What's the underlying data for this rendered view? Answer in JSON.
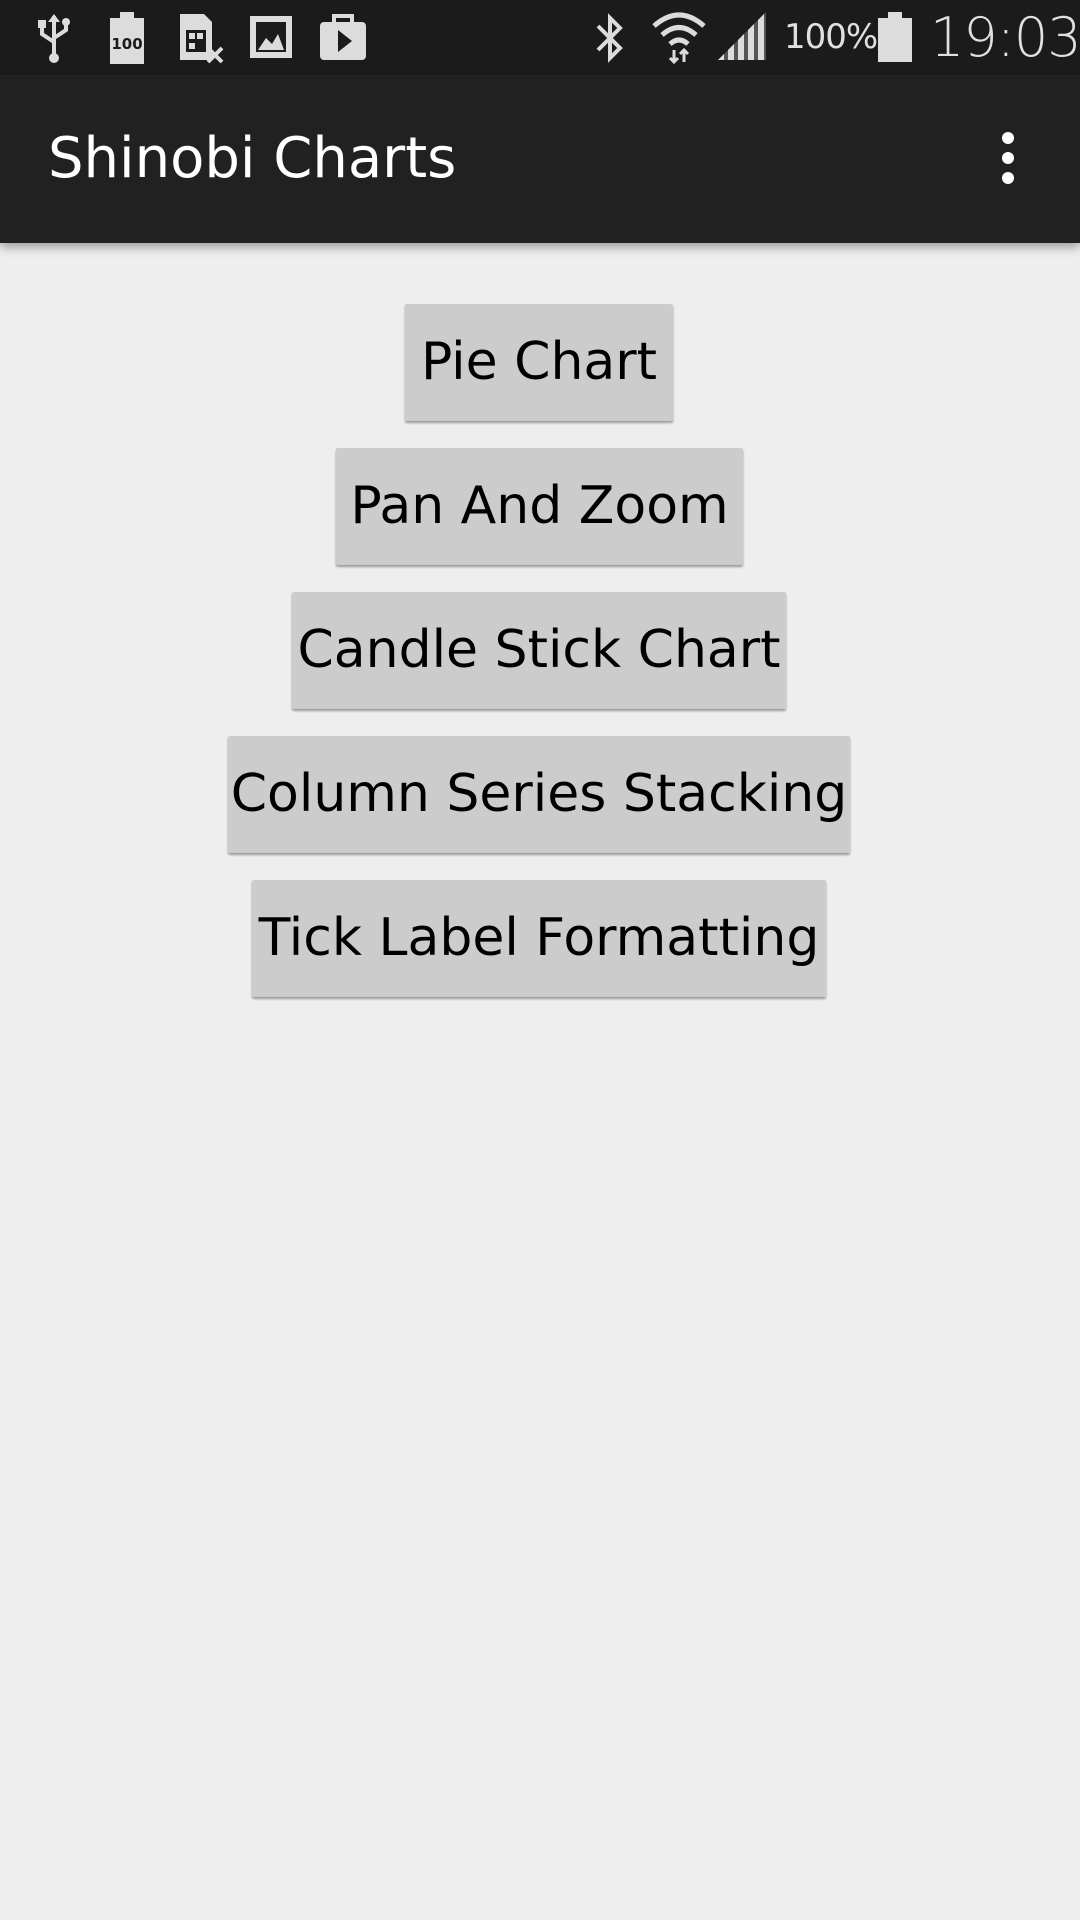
{
  "status_bar": {
    "left_icons": [
      "usb-icon",
      "battery-100-icon",
      "sim-card-icon",
      "image-icon",
      "play-store-icon"
    ],
    "right_icons": [
      "bluetooth-icon",
      "wifi-icon",
      "signal-icon",
      "battery-icon"
    ],
    "battery_percent": "100%",
    "time": "19:03"
  },
  "app_bar": {
    "title": "Shinobi Charts",
    "menu_icon": "overflow-menu-icon"
  },
  "buttons": [
    {
      "label": "Pie Chart"
    },
    {
      "label": "Pan And Zoom"
    },
    {
      "label": "Candle Stick Chart"
    },
    {
      "label": "Column Series Stacking"
    },
    {
      "label": "Tick Label Formatting"
    }
  ],
  "colors": {
    "status_bar_bg": "#1b1b1b",
    "app_bar_bg": "#212121",
    "page_bg": "#eeeeee",
    "button_bg": "#cccccc"
  }
}
